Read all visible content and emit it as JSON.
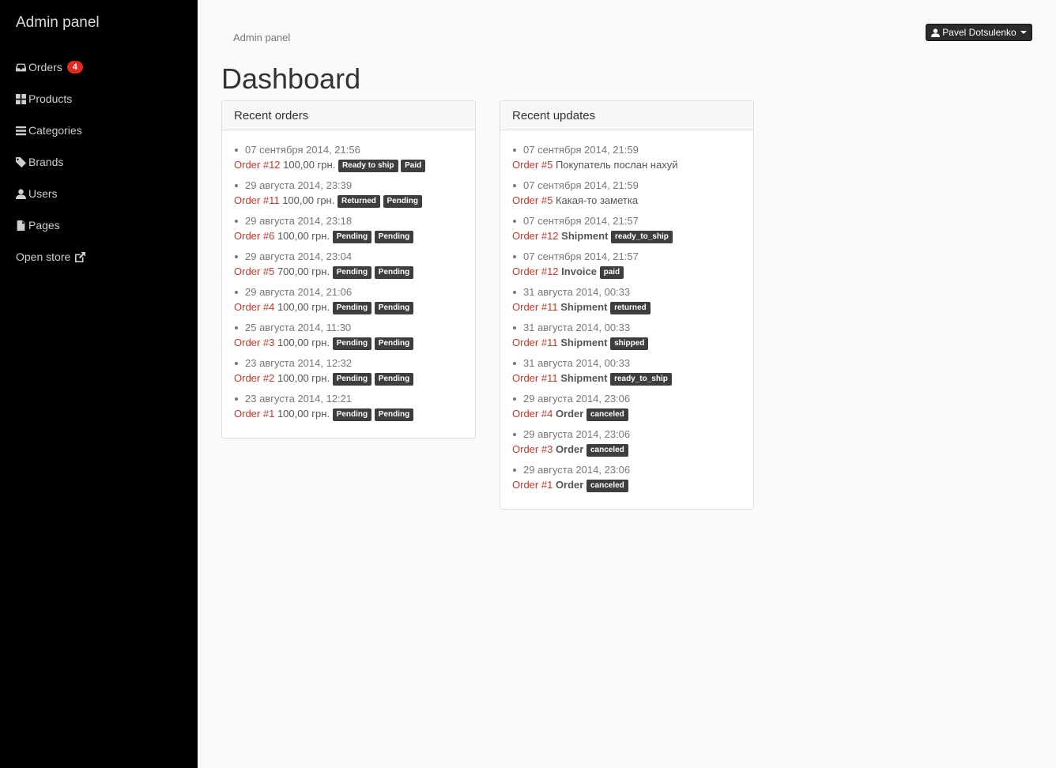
{
  "brand": "Admin panel",
  "nav": {
    "orders": "Orders",
    "orders_count": "4",
    "products": "Products",
    "categories": "Categories",
    "brands": "Brands",
    "users": "Users",
    "pages": "Pages",
    "open_store": "Open store"
  },
  "breadcrumb": "Admin panel",
  "user": {
    "name": "Pavel Dotsulenko"
  },
  "page_title": "Dashboard",
  "recent_orders": {
    "title": "Recent orders",
    "items": [
      {
        "date": "07 сентября 2014, 21:56",
        "order": "Order #12",
        "amount": "100,00 грн.",
        "badges": [
          "Ready to ship",
          "Paid"
        ]
      },
      {
        "date": "29 августа 2014, 23:39",
        "order": "Order #11",
        "amount": "100,00 грн.",
        "badges": [
          "Returned",
          "Pending"
        ]
      },
      {
        "date": "29 августа 2014, 23:18",
        "order": "Order #6",
        "amount": "100,00 грн.",
        "badges": [
          "Pending",
          "Pending"
        ]
      },
      {
        "date": "29 августа 2014, 23:04",
        "order": "Order #5",
        "amount": "700,00 грн.",
        "badges": [
          "Pending",
          "Pending"
        ]
      },
      {
        "date": "29 августа 2014, 21:06",
        "order": "Order #4",
        "amount": "100,00 грн.",
        "badges": [
          "Pending",
          "Pending"
        ]
      },
      {
        "date": "25 августа 2014, 11:30",
        "order": "Order #3",
        "amount": "100,00 грн.",
        "badges": [
          "Pending",
          "Pending"
        ]
      },
      {
        "date": "23 августа 2014, 12:32",
        "order": "Order #2",
        "amount": "100,00 грн.",
        "badges": [
          "Pending",
          "Pending"
        ]
      },
      {
        "date": "23 августа 2014, 12:21",
        "order": "Order #1",
        "amount": "100,00 грн.",
        "badges": [
          "Pending",
          "Pending"
        ]
      }
    ]
  },
  "recent_updates": {
    "title": "Recent updates",
    "items": [
      {
        "date": "07 сентября 2014, 21:59",
        "order": "Order #5",
        "text": "Покупатель послан нахуй",
        "kind": "",
        "badge": ""
      },
      {
        "date": "07 сентября 2014, 21:59",
        "order": "Order #5",
        "text": "Какая-то заметка",
        "kind": "",
        "badge": ""
      },
      {
        "date": "07 сентября 2014, 21:57",
        "order": "Order #12",
        "text": "",
        "kind": "Shipment",
        "badge": "ready_to_ship"
      },
      {
        "date": "07 сентября 2014, 21:57",
        "order": "Order #12",
        "text": "",
        "kind": "Invoice",
        "badge": "paid"
      },
      {
        "date": "31 августа 2014, 00:33",
        "order": "Order #11",
        "text": "",
        "kind": "Shipment",
        "badge": "returned"
      },
      {
        "date": "31 августа 2014, 00:33",
        "order": "Order #11",
        "text": "",
        "kind": "Shipment",
        "badge": "shipped"
      },
      {
        "date": "31 августа 2014, 00:33",
        "order": "Order #11",
        "text": "",
        "kind": "Shipment",
        "badge": "ready_to_ship"
      },
      {
        "date": "29 августа 2014, 23:06",
        "order": "Order #4",
        "text": "",
        "kind": "Order",
        "badge": "canceled"
      },
      {
        "date": "29 августа 2014, 23:06",
        "order": "Order #3",
        "text": "",
        "kind": "Order",
        "badge": "canceled"
      },
      {
        "date": "29 августа 2014, 23:06",
        "order": "Order #1",
        "text": "",
        "kind": "Order",
        "badge": "canceled"
      }
    ]
  },
  "colors": {
    "sidebar_bg": "#000000",
    "link_red": "#c0392b",
    "badge_red": "#e12a1f",
    "label_bg": "#3e3e3e"
  },
  "icons": [
    "inbox-icon",
    "th-large-icon",
    "list-icon",
    "tags-icon",
    "user-icon",
    "file-icon",
    "external-link-icon",
    "caret-down-icon"
  ]
}
